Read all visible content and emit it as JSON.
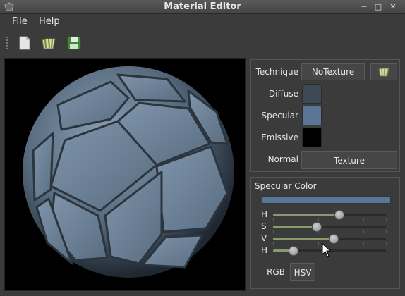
{
  "window": {
    "title": "Material Editor",
    "controls": [
      "minimize-icon",
      "maximize-icon",
      "close-icon"
    ]
  },
  "menu": {
    "items": [
      "File",
      "Help"
    ]
  },
  "toolbar": {
    "buttons": [
      "new-file-icon",
      "open-file-icon",
      "save-icon"
    ]
  },
  "viewport": {
    "background": "#000000",
    "model_color": "#5f7489"
  },
  "properties": {
    "technique_label": "Technique",
    "technique_value": "NoTexture",
    "diffuse_label": "Diffuse",
    "specular_label": "Specular",
    "emissive_label": "Emissive",
    "normal_label": "Normal",
    "normal_button": "Texture",
    "colors": {
      "diffuse": "#3e4956",
      "specular": "#5b7694",
      "emissive": "#000000"
    }
  },
  "specular_color": {
    "title": "Specular Color",
    "preview_color": "#5b7694",
    "sliders": [
      {
        "label": "H",
        "value": 0.59
      },
      {
        "label": "S",
        "value": 0.39
      },
      {
        "label": "V",
        "value": 0.54
      },
      {
        "label": "H",
        "value": 0.18
      }
    ],
    "tabs": [
      "RGB",
      "HSV"
    ],
    "active_tab": "HSV"
  }
}
